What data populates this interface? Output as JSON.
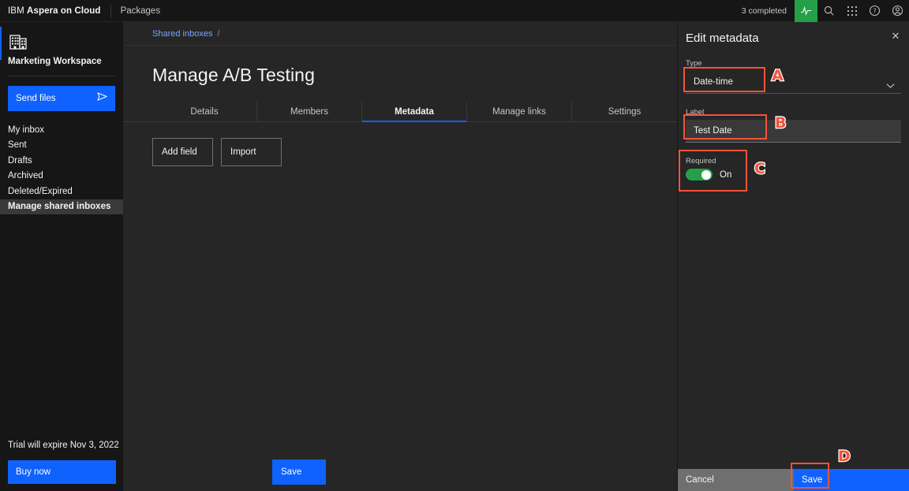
{
  "header": {
    "brand_ibm": "IBM",
    "brand_product": "Aspera on Cloud",
    "packages_label": "Packages",
    "completed_count": "3 completed",
    "icons": [
      "activity-icon",
      "search-icon",
      "app-switcher-icon",
      "help-icon",
      "user-avatar-icon"
    ]
  },
  "sidebar": {
    "workspace_icon": "building-icon",
    "workspace_name": "Marketing Workspace",
    "send_files_label": "Send files",
    "send_files_icon": "send-arrow-icon",
    "items": [
      {
        "label": "My inbox",
        "selected": false
      },
      {
        "label": "Sent",
        "selected": false
      },
      {
        "label": "Drafts",
        "selected": false
      },
      {
        "label": "Archived",
        "selected": false
      },
      {
        "label": "Deleted/Expired",
        "selected": false
      },
      {
        "label": "Manage shared inboxes",
        "selected": true
      }
    ],
    "trial_notice": "Trial will expire Nov 3, 2022",
    "buy_now_label": "Buy now"
  },
  "main": {
    "breadcrumb_link": "Shared inboxes",
    "breadcrumb_separator": "/",
    "page_title": "Manage A/B Testing",
    "tabs": [
      {
        "label": "Details",
        "active": false
      },
      {
        "label": "Members",
        "active": false
      },
      {
        "label": "Metadata",
        "active": true
      },
      {
        "label": "Manage links",
        "active": false
      },
      {
        "label": "Settings",
        "active": false
      }
    ],
    "add_field_label": "Add field",
    "import_label": "Import",
    "save_label": "Save"
  },
  "panel": {
    "title": "Edit metadata",
    "close_icon": "close-icon",
    "type_label": "Type",
    "type_value": "Date-time",
    "type_chevron_icon": "chevron-down-icon",
    "label_label": "Label",
    "label_value": "Test Date",
    "label_placeholder": "Test Date",
    "required_label": "Required",
    "required_state": "On",
    "cancel_label": "Cancel",
    "save_label": "Save"
  },
  "annotations": [
    {
      "letter": "A",
      "target": "type-select"
    },
    {
      "letter": "B",
      "target": "label-input"
    },
    {
      "letter": "C",
      "target": "required-toggle"
    },
    {
      "letter": "D",
      "target": "panel-save-button"
    }
  ],
  "colors": {
    "accent_blue": "#0f62fe",
    "link_blue": "#78a9ff",
    "toggle_green": "#24a148",
    "annotation_red": "#f4533a",
    "panel_bg": "#262626",
    "app_bg": "#161616"
  }
}
